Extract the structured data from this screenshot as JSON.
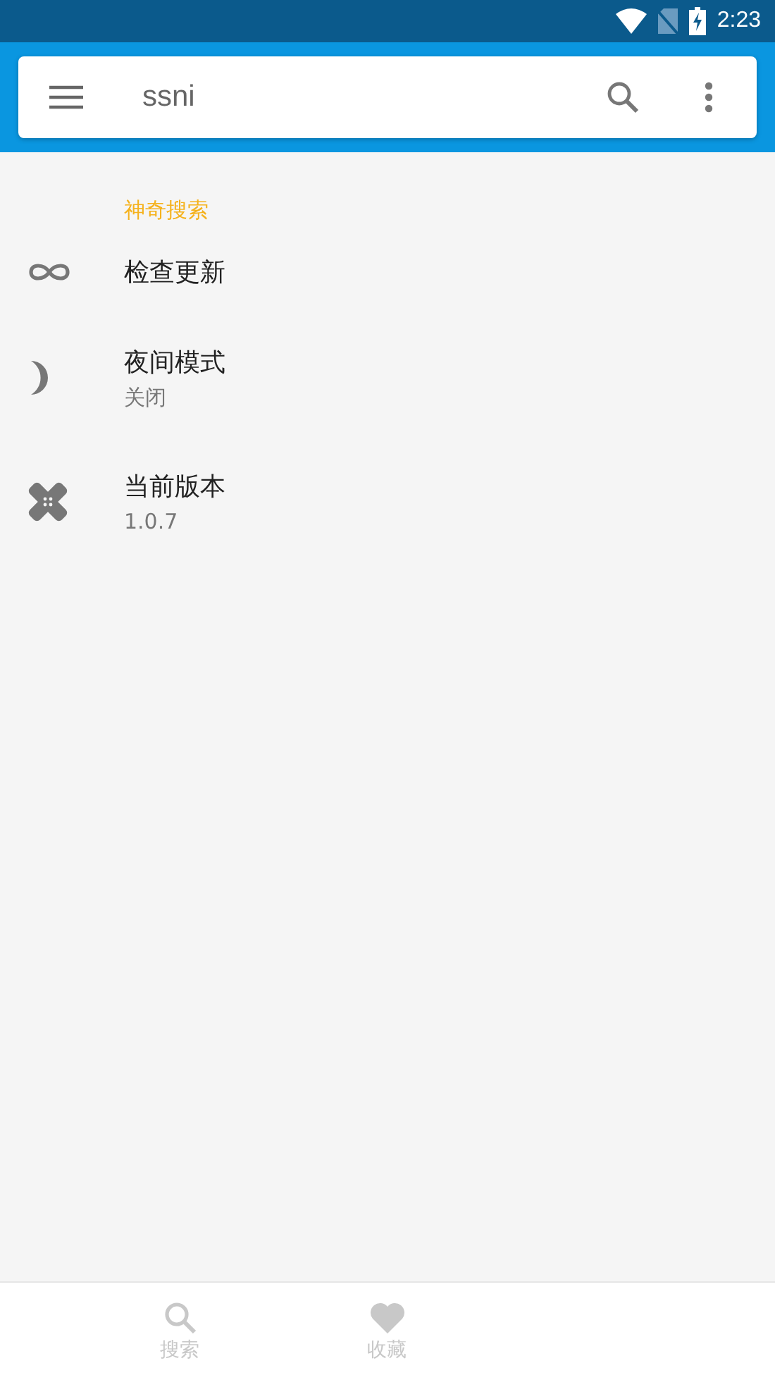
{
  "status_bar": {
    "time": "2:23"
  },
  "search_bar": {
    "value": "ssni"
  },
  "section": {
    "title": "神奇搜索"
  },
  "settings": [
    {
      "kind": "infinity",
      "title": "检查更新"
    },
    {
      "kind": "moon",
      "title": "夜间模式",
      "subtitle": "关闭"
    },
    {
      "kind": "bandage",
      "title": "当前版本",
      "subtitle": "1.0.7"
    }
  ],
  "bottom_nav": [
    {
      "kind": "search",
      "label": "搜索",
      "selected": false
    },
    {
      "kind": "heart",
      "label": "收藏",
      "selected": false
    }
  ]
}
